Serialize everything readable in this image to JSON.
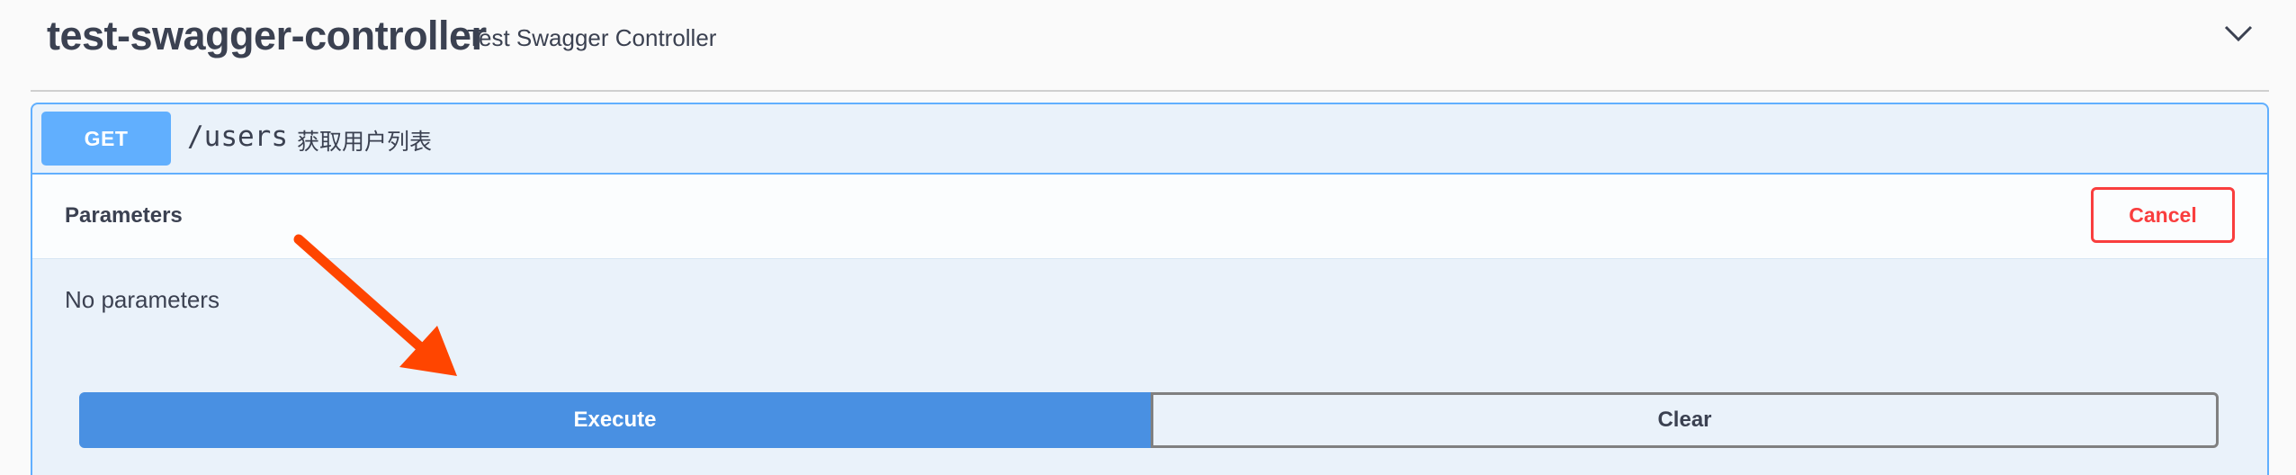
{
  "tag": {
    "name": "test-swagger-controller",
    "description": "Test Swagger Controller",
    "collapse_icon": "chevron-down-icon"
  },
  "operation": {
    "method": "GET",
    "path": "/users",
    "summary": "获取用户列表"
  },
  "parameters": {
    "title": "Parameters",
    "cancel_label": "Cancel",
    "empty_text": "No parameters"
  },
  "actions": {
    "execute_label": "Execute",
    "clear_label": "Clear"
  },
  "annotation": {
    "icon": "arrow-icon",
    "color": "#ff4500"
  },
  "colors": {
    "get_accent": "#61affe",
    "execute": "#4990e2",
    "cancel": "#f93e3e",
    "text": "#3b4151"
  }
}
